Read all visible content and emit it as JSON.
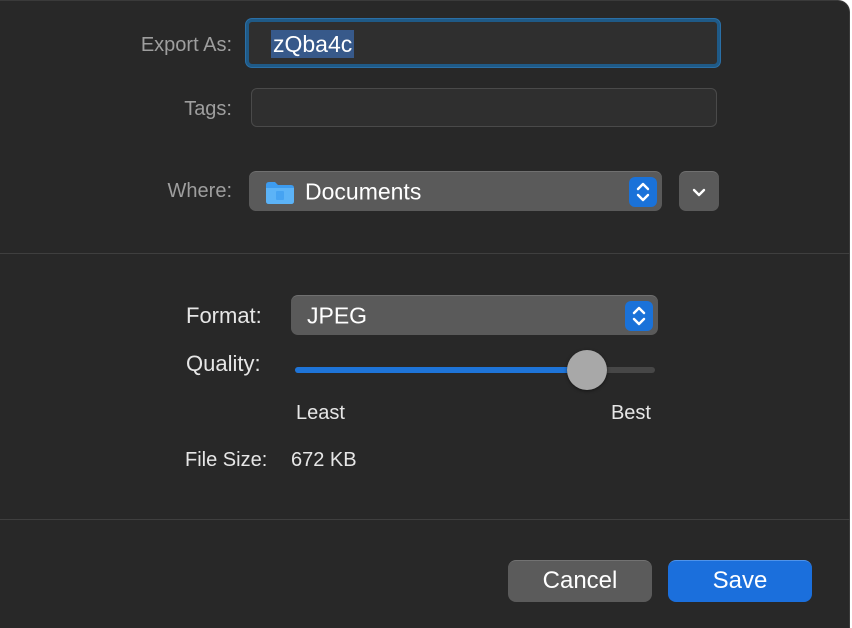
{
  "export": {
    "label": "Export As:",
    "filename": "zQba4c"
  },
  "tags": {
    "label": "Tags:",
    "value": ""
  },
  "where": {
    "label": "Where:",
    "folder": "Documents",
    "folder_icon": "folder-icon"
  },
  "format": {
    "label": "Format:",
    "value": "JPEG"
  },
  "quality": {
    "label": "Quality:",
    "level": 0.81,
    "min_label": "Least",
    "max_label": "Best"
  },
  "file_size": {
    "label": "File Size:",
    "value": "672 KB"
  },
  "buttons": {
    "cancel": "Cancel",
    "save": "Save"
  },
  "colors": {
    "accent": "#1b6fdc",
    "background": "#282828",
    "selection": "#37598a"
  }
}
